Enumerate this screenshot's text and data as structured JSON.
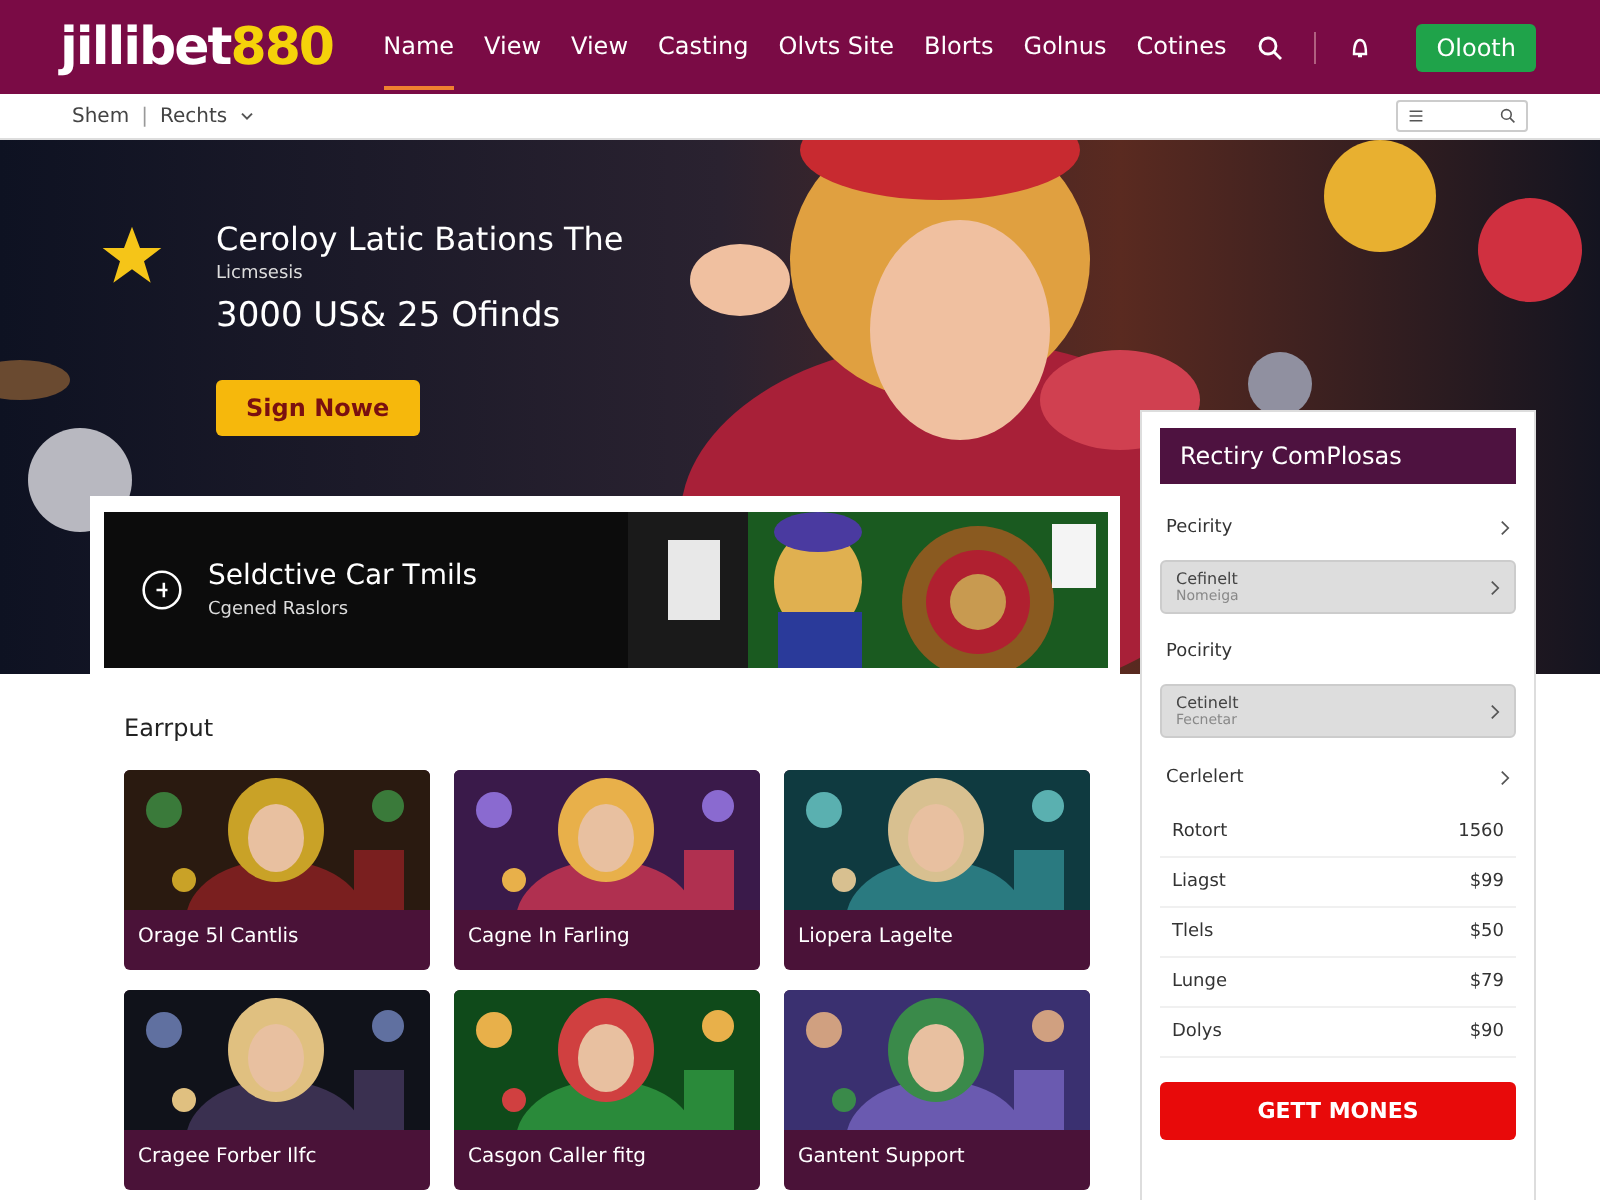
{
  "header": {
    "logo_main": "jillibet",
    "logo_accent": "880",
    "nav": [
      {
        "label": "Name",
        "selected": true
      },
      {
        "label": "View",
        "selected": false
      },
      {
        "label": "View",
        "selected": false
      },
      {
        "label": "Casting",
        "selected": false
      },
      {
        "label": "Olvts Site",
        "selected": false
      },
      {
        "label": "Blorts",
        "selected": false
      },
      {
        "label": "Golnus",
        "selected": false
      },
      {
        "label": "Cotines",
        "selected": false
      }
    ],
    "action_button": "Olooth"
  },
  "subbar": {
    "crumbs": [
      "Shem",
      "Rechts"
    ],
    "separator": "|"
  },
  "hero": {
    "heading": "Ceroloy Latic Bations The",
    "kicker": "Licmsesis",
    "offer": "3000 US& 25 Ofinds",
    "button": "Sign Nowe"
  },
  "banner": {
    "title": "Seldctive Car Tmils",
    "subtitle": "Cgened Raslors"
  },
  "section": {
    "title": "Earrput",
    "cards": [
      {
        "title": "Orage 5l Cantlis"
      },
      {
        "title": "Cagne In Farling"
      },
      {
        "title": "Liopera Lagelte"
      },
      {
        "title": "Cragee Forber Ilfc"
      },
      {
        "title": "Casgon Caller fitg"
      },
      {
        "title": "Gantent Support"
      }
    ]
  },
  "panel": {
    "title": "Rectiry ComPlosas",
    "items": [
      {
        "kind": "link",
        "label": "Pecirity"
      },
      {
        "kind": "card",
        "label": "Cefinelt",
        "sub": "Nomeiga"
      },
      {
        "kind": "heading",
        "label": "Pocirity"
      },
      {
        "kind": "card",
        "label": "Cetinelt",
        "sub": "Fecnetar"
      },
      {
        "kind": "link",
        "label": "Cerlelert"
      },
      {
        "kind": "value",
        "label": "Rotort",
        "value": "1560"
      },
      {
        "kind": "value",
        "label": "Liagst",
        "value": "$99"
      },
      {
        "kind": "value",
        "label": "Tlels",
        "value": "$50"
      },
      {
        "kind": "value",
        "label": "Lunge",
        "value": "$79"
      },
      {
        "kind": "value",
        "label": "Dolys",
        "value": "$90"
      }
    ],
    "button": "GETT MONES"
  }
}
